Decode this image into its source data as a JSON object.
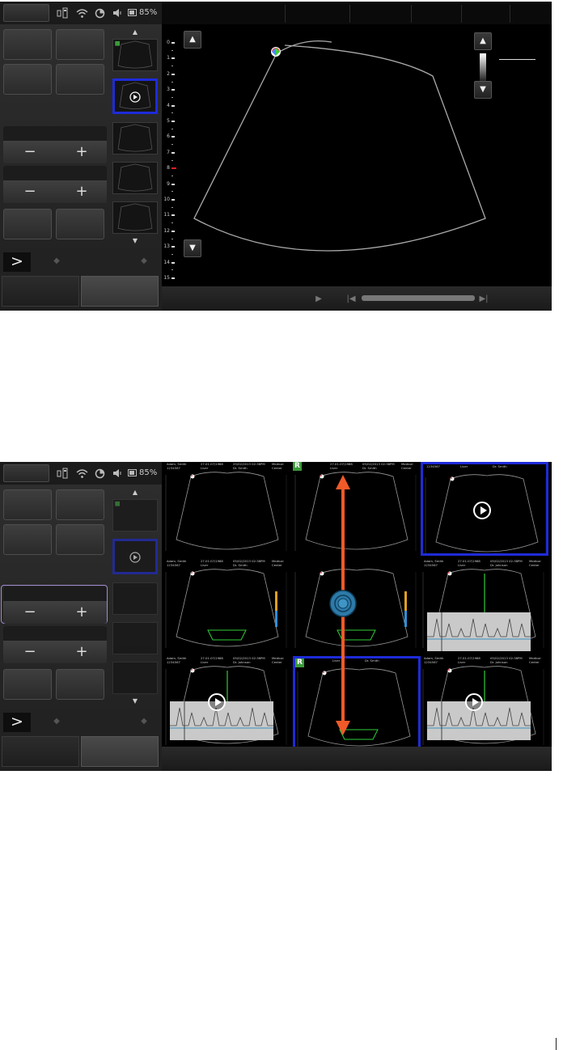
{
  "status": {
    "battery": "85%",
    "battery_level": 0.85
  },
  "icons": [
    "storage-icon",
    "wifi-icon",
    "power-icon",
    "speaker-icon",
    "battery-icon"
  ],
  "depth_scale": [
    "0",
    "1",
    "2",
    "3",
    "4",
    "5",
    "6",
    "7",
    "8",
    "9",
    "10",
    "11",
    "12",
    "13",
    "14",
    "15"
  ],
  "colors": {
    "selection": "#1e2bd8",
    "gesture_arrow": "#f05a28",
    "stepper_outline": "#a38bd0",
    "depth_marker": "#e02020",
    "r_badge": "#3b9b3b"
  },
  "grid": {
    "cells": [
      {
        "patient": "Adam, Smith\n1234567",
        "exam": "27.01.07/1988\nLiver",
        "date": "25/02/2013 02:38PM\nDr. Smith",
        "site": "Medical\nCenter"
      },
      {
        "patient": "",
        "exam": "27.01.07/1988\nLiver",
        "date": "05/02/2013 02:38PM\nDr. Smith",
        "site": "Medical\nCenter"
      },
      {
        "patient": "1234567",
        "exam": "Liver",
        "date": "Dr. Smith",
        "site": ""
      },
      {
        "patient": "Adam, Smith\n1234567",
        "exam": "27.01.07/1988\nLiver",
        "date": "05/02/2013 02:38PM\nDr. Smith",
        "site": "Medical\nCenter"
      },
      {
        "patient": "",
        "exam": "",
        "date": "",
        "site": ""
      },
      {
        "patient": "Adam, Smith\n1234567",
        "exam": "27.01.07/1988\nLiver",
        "date": "05/02/2013 02:38PM\nDr. Johnson",
        "site": "Medical\nCenter"
      },
      {
        "patient": "Adam, Smith\n1234567",
        "exam": "27.01.07/1988\nLiver",
        "date": "05/02/2013 02:38PM\nDr. Johnson",
        "site": "Medical\nCenter"
      },
      {
        "patient": "",
        "exam": "Liver",
        "date": "Dr. Smith",
        "site": ""
      },
      {
        "patient": "Adam, Smith\n1234567",
        "exam": "27.01.07/1988\nLiver",
        "date": "05/02/2013 02:38PM\nDr. Johnson",
        "site": "Medical\nCenter"
      }
    ]
  }
}
